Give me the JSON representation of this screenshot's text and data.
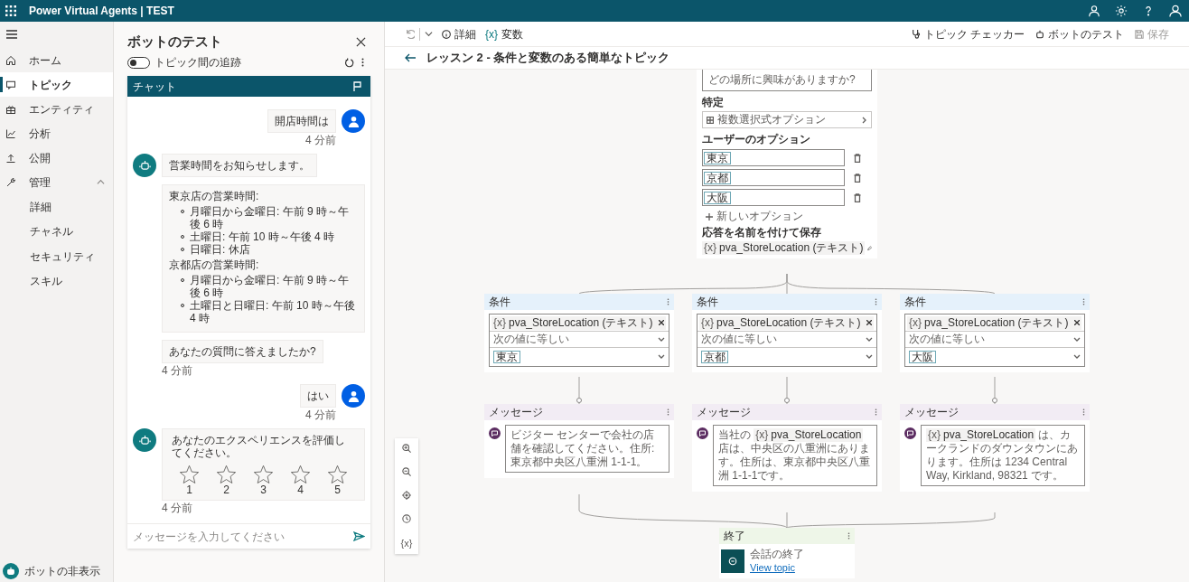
{
  "app_title": "Power Virtual Agents | TEST",
  "nav": {
    "items": [
      {
        "label": "ホーム",
        "selected": false
      },
      {
        "label": "トピック",
        "selected": true
      },
      {
        "label": "エンティティ",
        "selected": false
      },
      {
        "label": "分析",
        "selected": false
      },
      {
        "label": "公開",
        "selected": false
      },
      {
        "label": "管理",
        "selected": false,
        "expanded": true,
        "children": [
          {
            "label": "詳細",
            "selected": false
          },
          {
            "label": "チャネル",
            "selected": false
          },
          {
            "label": "セキュリティ",
            "selected": false
          },
          {
            "label": "スキル",
            "selected": false
          }
        ]
      }
    ],
    "footer": "ボットの非表示"
  },
  "test_panel": {
    "title": "ボットのテスト",
    "toggle": {
      "label": "トピック間の追跡",
      "on": false
    },
    "chat_title": "チャット",
    "messages": [
      {
        "kind": "user",
        "text": "開店時間は",
        "time": "4 分前"
      },
      {
        "kind": "bot",
        "text": "営業時間をお知らせします。"
      },
      {
        "kind": "bot_list",
        "sections": [
          {
            "heading": "東京店の営業時間:",
            "bullets": [
              "月曜日から金曜日: 午前 9 時～午後 6 時",
              "土曜日: 午前 10 時～午後 4 時",
              "日曜日: 休店"
            ]
          },
          {
            "heading": "京都店の営業時間:",
            "bullets": [
              "月曜日から金曜日: 午前 9 時～午後 6 時",
              "土曜日と日曜日: 午前 10 時～午後 4 時"
            ]
          }
        ]
      },
      {
        "kind": "bot",
        "text": "あなたの質問に答えましたか?",
        "time": "4 分前"
      },
      {
        "kind": "user",
        "text": "はい",
        "time": "4 分前"
      },
      {
        "kind": "bot_rating",
        "text": "あなたのエクスペリエンスを評価してください。",
        "stars": 0,
        "labels": [
          "1",
          "2",
          "3",
          "4",
          "5"
        ],
        "time": "4 分前"
      }
    ],
    "composer": {
      "placeholder": "メッセージを入力してください"
    }
  },
  "toolbar": {
    "details": "詳細",
    "variables_glyph": "{x}",
    "variables": "変数",
    "topic_checker": "トピック チェッカー",
    "test_bot": "ボットのテスト",
    "save": {
      "label": "保存",
      "disabled": true
    }
  },
  "page_title": "レッスン 2 - 条件と変数のある簡単なトピック",
  "canvas": {
    "question": {
      "text": "どの場所に興味がありますか?",
      "identify_label": "特定",
      "identify_value": "複数選択式オプション",
      "options_label": "ユーザーのオプション",
      "options": [
        "東京",
        "京都",
        "大阪"
      ],
      "new_option": "新しいオプション",
      "save_label": "応答を名前を付けて保存",
      "variable": {
        "glyph": "{x}",
        "name": "pva_StoreLocation (テキスト)"
      }
    },
    "conditions": [
      {
        "header": "条件",
        "variable": {
          "glyph": "{x}",
          "name": "pva_StoreLocation (テキスト)"
        },
        "operator": "次の値に等しい",
        "value": "東京"
      },
      {
        "header": "条件",
        "variable": {
          "glyph": "{x}",
          "name": "pva_StoreLocation (テキスト)"
        },
        "operator": "次の値に等しい",
        "value": "京都"
      },
      {
        "header": "条件",
        "variable": {
          "glyph": "{x}",
          "name": "pva_StoreLocation (テキスト)"
        },
        "operator": "次の値に等しい",
        "value": "大阪"
      }
    ],
    "messages": [
      {
        "header": "メッセージ",
        "parts": [
          {
            "kind": "text",
            "text": "ビジター センターで会社の店舗を確認してください。住所: 東京都中央区八重洲 1-1-1。"
          }
        ]
      },
      {
        "header": "メッセージ",
        "parts": [
          {
            "kind": "text",
            "text": "当社の"
          },
          {
            "kind": "variable",
            "glyph": "{x}",
            "text": "pva_StoreLocation"
          },
          {
            "kind": "text",
            "text": "店は、中央区の八重洲にあります。住所は、東京都中央区八重洲 1-1-1です。"
          }
        ]
      },
      {
        "header": "メッセージ",
        "parts": [
          {
            "kind": "variable",
            "glyph": "{x}",
            "text": "pva_StoreLocation"
          },
          {
            "kind": "text",
            "text": "は、カークランドのダウンタウンにあります。住所は 1234 Central Way, Kirkland, 98321 です。"
          }
        ]
      }
    ],
    "end": {
      "header": "終了",
      "action": "会話の終了",
      "link": "View topic"
    },
    "tools_glyph": "{x}"
  }
}
